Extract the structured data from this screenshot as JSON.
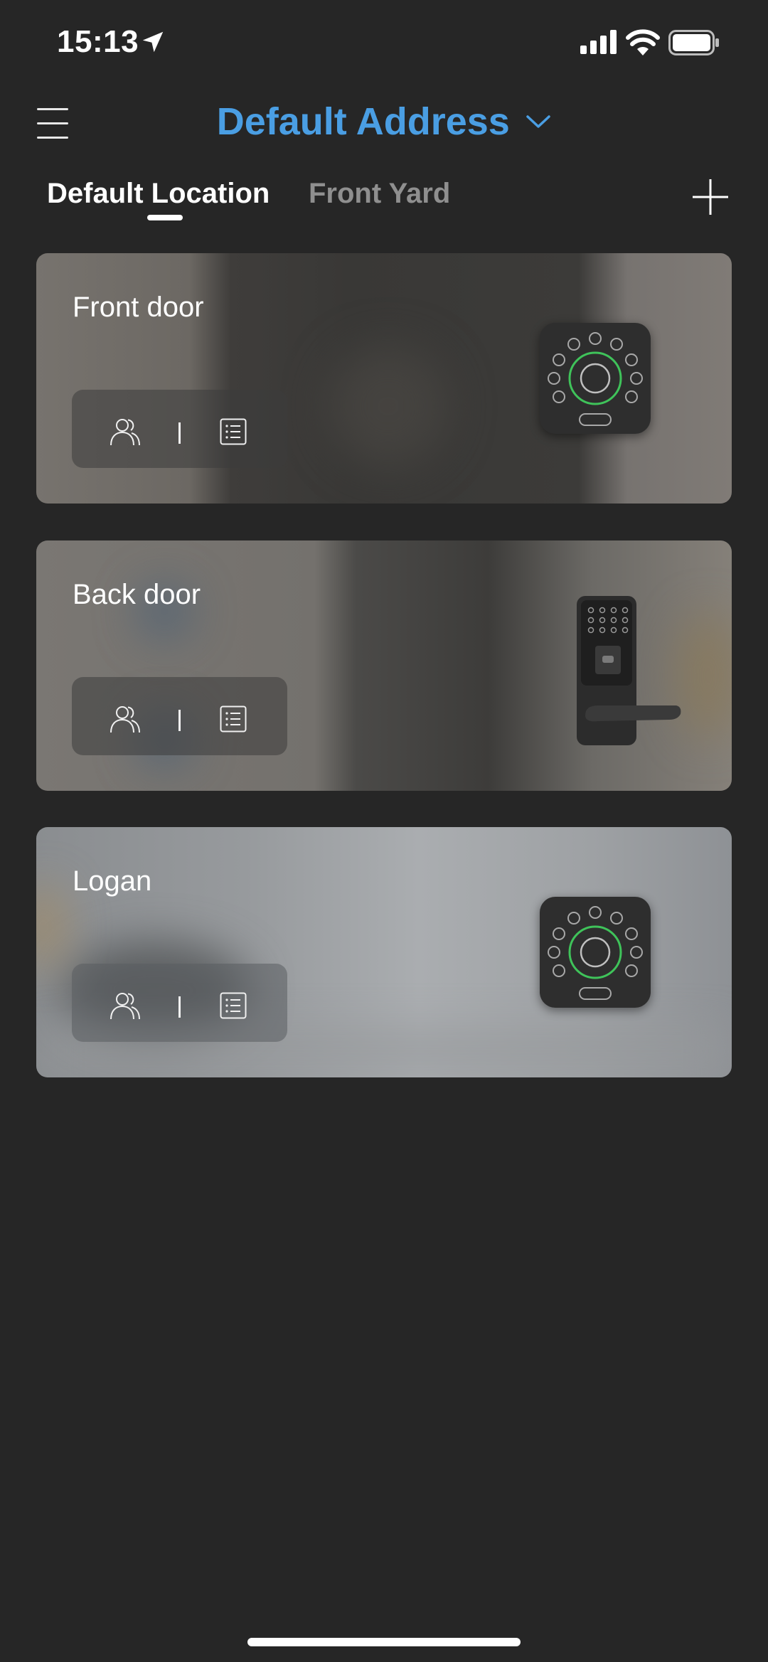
{
  "status_bar": {
    "time": "15:13",
    "location_icon": "location-arrow-icon",
    "signal_icon": "cellular-signal-icon",
    "wifi_icon": "wifi-icon",
    "battery_icon": "battery-icon"
  },
  "header": {
    "menu_icon": "hamburger-menu-icon",
    "address_title": "Default Address",
    "address_chevron_icon": "chevron-down-icon",
    "accent_color": "#4a9ee3"
  },
  "tabs": [
    {
      "label": "Default Location",
      "active": true
    },
    {
      "label": "Front Yard",
      "active": false
    }
  ],
  "add_icon": "plus-icon",
  "devices": [
    {
      "name": "Front door",
      "lock_image": "keypad-lock-icon"
    },
    {
      "name": "Back door",
      "lock_image": "lever-lock-icon"
    },
    {
      "name": "Logan",
      "lock_image": "keypad-lock-icon"
    }
  ],
  "device_actions": {
    "users_icon": "users-icon",
    "log_icon": "list-icon"
  },
  "colors": {
    "background": "#262626",
    "keypad_ring": "#3fc35a"
  }
}
